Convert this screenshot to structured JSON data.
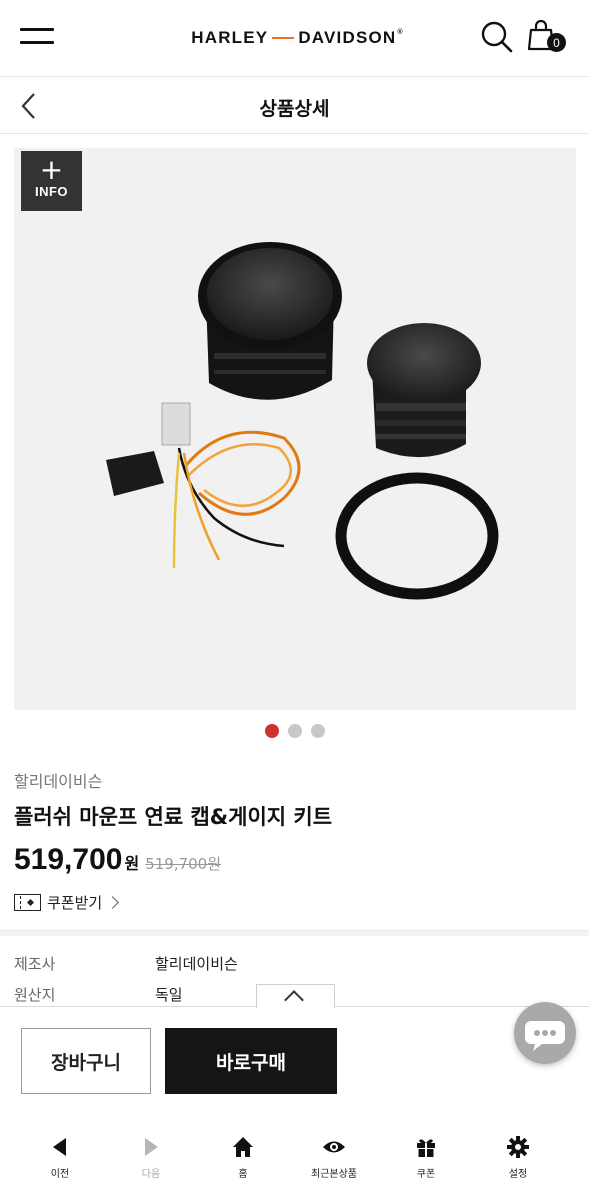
{
  "header": {
    "logo_left": "HARLEY",
    "logo_right": "DAVIDSON",
    "cart_count": "0"
  },
  "subheader": {
    "title": "상품상세"
  },
  "product": {
    "info_badge_label": "INFO",
    "brand": "할리데이비슨",
    "name": "플러쉬 마운프 연료 캡&게이지 키트",
    "price": "519,700",
    "price_unit": "원",
    "original_price": "519,700원",
    "coupon_label": "쿠폰받기",
    "image_count": 3,
    "active_image_index": 0
  },
  "specs": [
    {
      "label": "제조사",
      "value": "할리데이비슨"
    },
    {
      "label": "원산지",
      "value": "독일"
    }
  ],
  "actions": {
    "add_to_cart": "장바구니",
    "buy_now": "바로구매"
  },
  "bottom_nav": [
    {
      "label": "이전",
      "icon": "back-triangle-icon",
      "enabled": true
    },
    {
      "label": "다음",
      "icon": "forward-triangle-icon",
      "enabled": false
    },
    {
      "label": "홈",
      "icon": "home-icon",
      "enabled": true
    },
    {
      "label": "최근본상품",
      "icon": "eye-icon",
      "enabled": true
    },
    {
      "label": "쿠폰",
      "icon": "gift-icon",
      "enabled": true
    },
    {
      "label": "설정",
      "icon": "gear-icon",
      "enabled": true
    }
  ],
  "colors": {
    "accent_orange": "#f26f21",
    "active_dot": "#d0302f",
    "buy_button": "#151515"
  }
}
